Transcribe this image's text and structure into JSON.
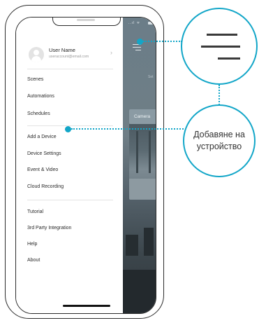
{
  "drawer": {
    "user": {
      "name": "User Name",
      "email": "useraccount@email.com",
      "chevron": "›"
    },
    "menu_items": [
      {
        "label": "Scenes"
      },
      {
        "label": "Automations"
      },
      {
        "label": "Schedules"
      },
      {
        "label": "Add a Device"
      },
      {
        "label": "Device Settings"
      },
      {
        "label": "Event & Video"
      },
      {
        "label": "Cloud Recording"
      },
      {
        "label": "Tutorial"
      },
      {
        "label": "3rd Party Integration"
      },
      {
        "label": "Help"
      },
      {
        "label": "About"
      }
    ]
  },
  "background_app": {
    "status": "..ıl ᯤ",
    "partial_label": "Set",
    "camera_label": "Camera"
  },
  "callouts": {
    "menu_icon": "hamburger-menu-icon",
    "add_device": "Добавяне на устройство"
  },
  "colors": {
    "accent": "#12a6c8",
    "overlay": "#6b7d88"
  }
}
